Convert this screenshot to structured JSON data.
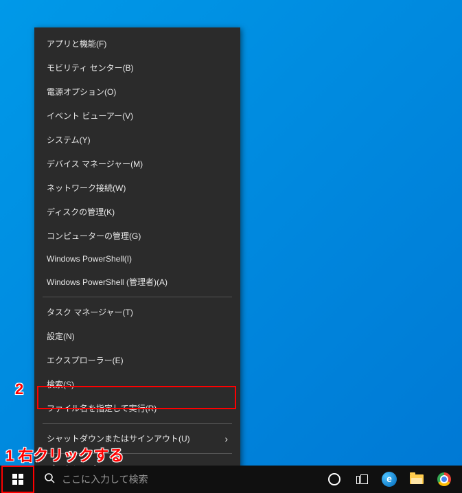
{
  "menu": {
    "group1": [
      "アプリと機能(F)",
      "モビリティ センター(B)",
      "電源オプション(O)",
      "イベント ビューアー(V)",
      "システム(Y)",
      "デバイス マネージャー(M)",
      "ネットワーク接続(W)",
      "ディスクの管理(K)",
      "コンピューターの管理(G)",
      "Windows PowerShell(I)",
      "Windows PowerShell (管理者)(A)"
    ],
    "group2": [
      "タスク マネージャー(T)",
      "設定(N)",
      "エクスプローラー(E)",
      "検索(S)",
      "ファイル名を指定して実行(R)"
    ],
    "group3": [
      {
        "label": "シャットダウンまたはサインアウト(U)",
        "submenu": true
      }
    ],
    "group4": [
      "デスクトップ(D)"
    ]
  },
  "search": {
    "placeholder": "ここに入力して検索"
  },
  "annotations": {
    "label1": "1 右クリックする",
    "label2": "2"
  }
}
